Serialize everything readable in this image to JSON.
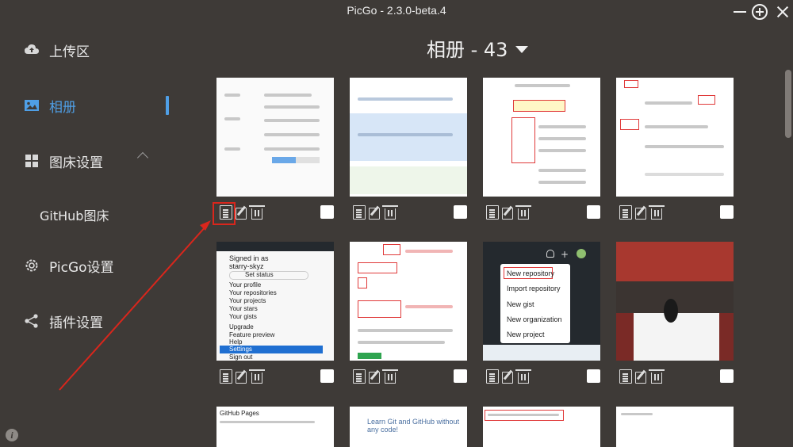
{
  "window": {
    "title": "PicGo - 2.3.0-beta.4"
  },
  "sidebar": {
    "items": [
      {
        "label": "上传区",
        "icon": "cloud-upload-icon"
      },
      {
        "label": "相册",
        "icon": "image-icon",
        "active": true
      },
      {
        "label": "图床设置",
        "icon": "grid-icon"
      },
      {
        "label": "GitHub图床"
      },
      {
        "label": "PicGo设置",
        "icon": "gear-icon"
      },
      {
        "label": "插件设置",
        "icon": "share-icon"
      }
    ]
  },
  "album": {
    "title": "相册 - 43"
  },
  "thumbs": {
    "t3": {
      "menu": [
        "New repository",
        "Import repository",
        "New gist",
        "New organization",
        "New project"
      ]
    },
    "t1": {
      "menu": [
        "Signed in as",
        "starry-skyz",
        "Set status",
        "Your profile",
        "Your repositories",
        "Your projects",
        "Your stars",
        "Your gists",
        "Upgrade",
        "Feature preview",
        "Help",
        "Settings",
        "Sign out"
      ]
    },
    "t4": {
      "text": "GitHub Pages"
    },
    "t5": {
      "text": "Learn Git and GitHub without any code!"
    }
  },
  "colors": {
    "accent": "#4f9fe6",
    "background": "#3e3a37",
    "annotation": "#d9261c"
  }
}
